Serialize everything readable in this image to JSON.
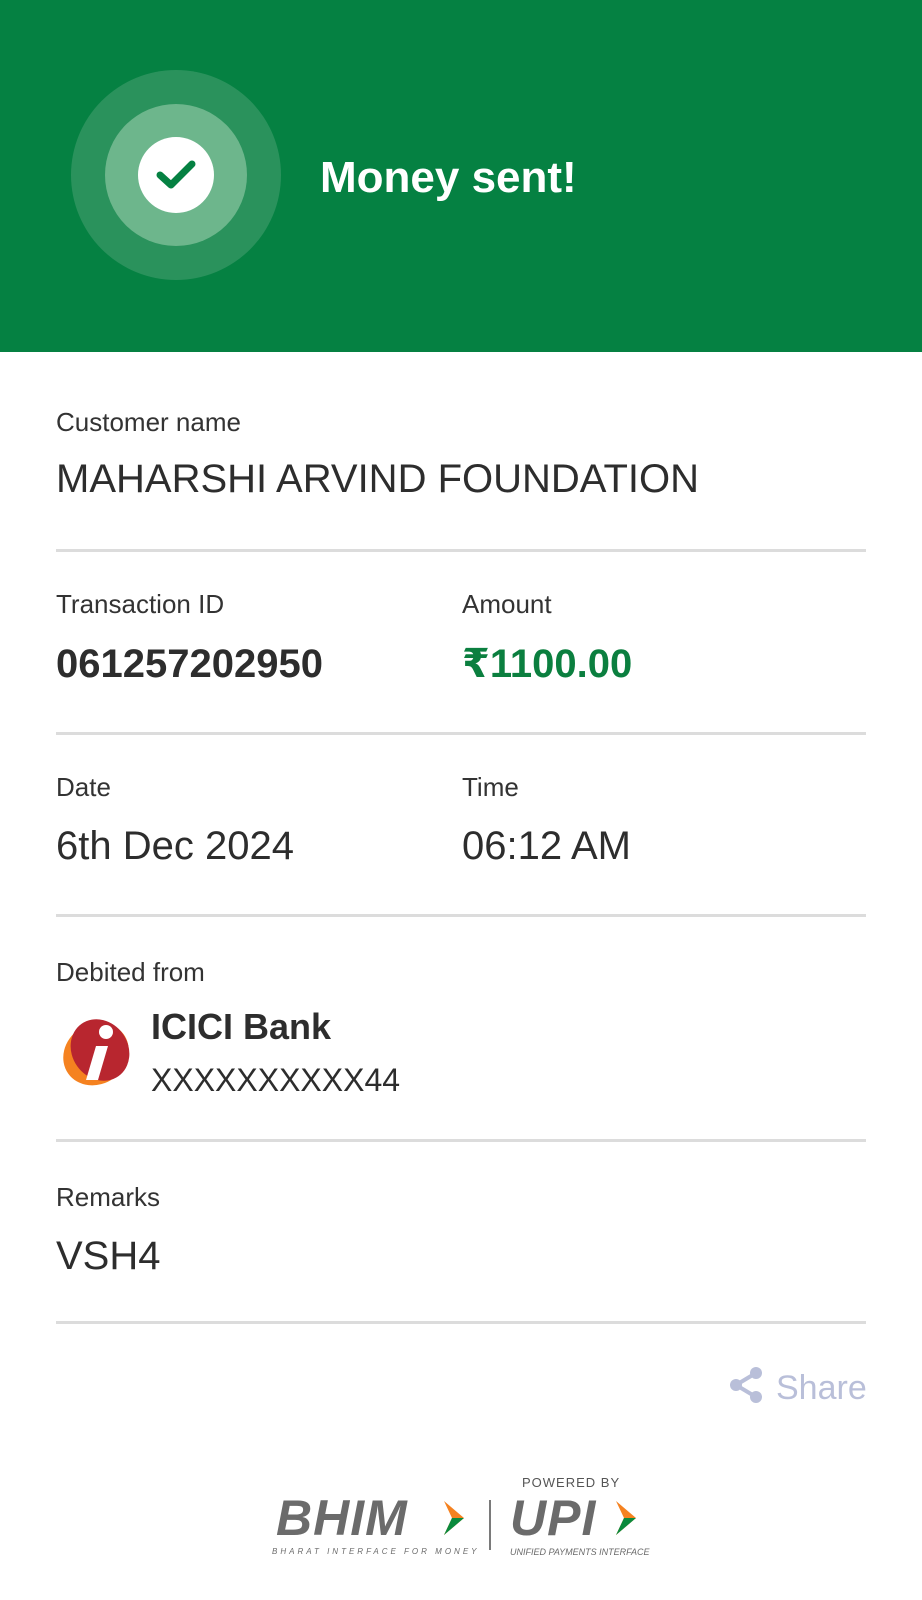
{
  "header": {
    "title": "Money sent!",
    "status_icon": "check-icon",
    "colors": {
      "background": "#058142",
      "ring_outer": "#2a925c",
      "ring_mid": "#6db68c"
    }
  },
  "customer": {
    "label": "Customer name",
    "value": "MAHARSHI ARVIND FOUNDATION"
  },
  "transaction": {
    "id_label": "Transaction ID",
    "id_value": "061257202950",
    "amount_label": "Amount",
    "amount_value": "₹1100.00",
    "amount_color": "#0b7f3f"
  },
  "datetime": {
    "date_label": "Date",
    "date_value": "6th Dec 2024",
    "time_label": "Time",
    "time_value": "06:12 AM"
  },
  "debit": {
    "label": "Debited from",
    "bank_name": "ICICI Bank",
    "account": "XXXXXXXXXX44",
    "bank_icon": "icici-logo-icon"
  },
  "remarks": {
    "label": "Remarks",
    "value": "VSH4"
  },
  "share": {
    "label": "Share",
    "icon": "share-icon",
    "color": "#b9bfd9"
  },
  "footer": {
    "bhim": "BHIM",
    "bhim_tagline": "BHARAT INTERFACE FOR MONEY",
    "powered_by": "POWERED BY",
    "upi": "UPI",
    "upi_tagline": "UNIFIED PAYMENTS INTERFACE"
  }
}
